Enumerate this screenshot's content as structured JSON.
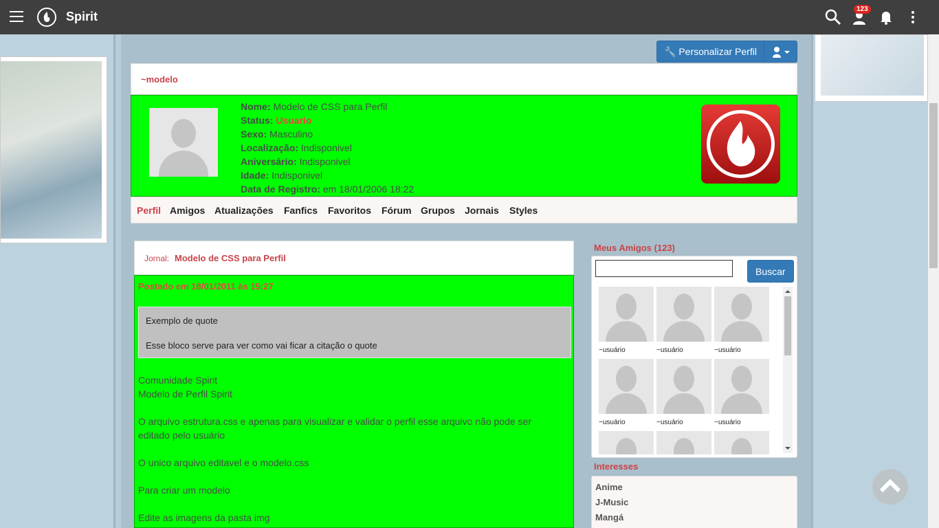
{
  "topbar": {
    "brand": "Spirit",
    "badge": "123"
  },
  "actions": {
    "customize": "Personalizar Perfil"
  },
  "profile": {
    "username": "~modelo",
    "fields": [
      {
        "label": "Nome:",
        "value": "Modelo de CSS para Perfil"
      },
      {
        "label": "Status:",
        "value": "Usuario"
      },
      {
        "label": "Sexo:",
        "value": "Masculino"
      },
      {
        "label": "Localização:",
        "value": "Indisponivel"
      },
      {
        "label": "Aniversário:",
        "value": "Indisponivel"
      },
      {
        "label": "Idade:",
        "value": "Indisponivel"
      },
      {
        "label": "Data de Registro:",
        "value": "em 18/01/2006 18:22"
      }
    ]
  },
  "tabs": [
    "Perfil",
    "Amigos",
    "Atualizações",
    "Fanfics",
    "Favoritos",
    "Fórum",
    "Grupos",
    "Jornais",
    "Styles"
  ],
  "journal": {
    "label": "Jornal:",
    "title": "Modelo de CSS para Perfil",
    "posted": "Postado em 18/01/2011 às 15:27",
    "quote_line1": "Exemplo de quote",
    "quote_line2": "Esse bloco serve para ver como vai ficar a citação o quote",
    "body": "Comunidade Spirit\nModelo de Perfil Spirit\n\nO arquivo estrutura.css e apenas para visualizar e validar o perfil esse arquivo não pode ser editado pelo usuário\n\nO unico arquivo editavel e o modelo.css\n\nPara criar um modelo\n\nEdite as imagens da pasta img"
  },
  "friends": {
    "title": "Meus Amigos (123)",
    "search_button": "Buscar",
    "name": "~usuário"
  },
  "interests": {
    "title": "Interesses",
    "items": [
      "Anime",
      "J-Music",
      "Mangá"
    ]
  }
}
